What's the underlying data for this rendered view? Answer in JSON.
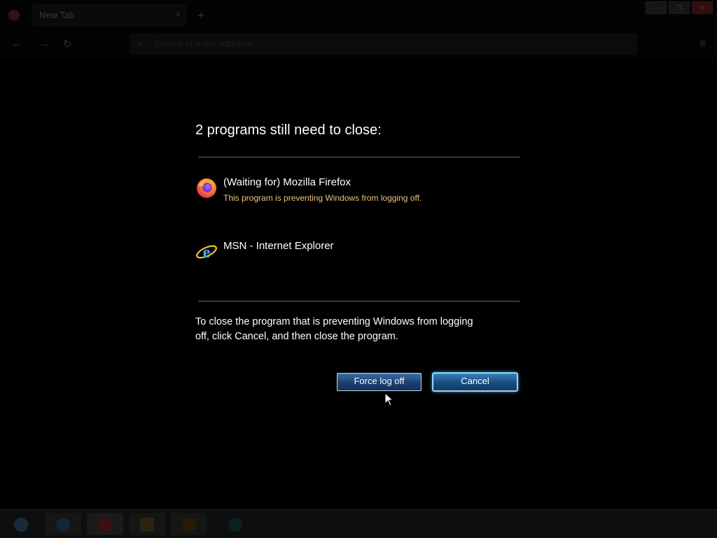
{
  "browser": {
    "tab_title": "New Tab",
    "tab_close": "×",
    "new_tab": "+",
    "search_placeholder": "Search or enter address",
    "window_buttons": [
      "—",
      "❐",
      "✕"
    ]
  },
  "dialog": {
    "title": "2 programs still need to close:",
    "programs": [
      {
        "name": "(Waiting for) Mozilla Firefox",
        "status": "This program is preventing Windows from logging off.",
        "icon": "firefox-icon"
      },
      {
        "name": "MSN - Internet Explorer",
        "icon": "internet-explorer-icon"
      }
    ],
    "instructions": "To close the program that is preventing Windows from logging off, click Cancel, and then close the program.",
    "force_button": "Force log off",
    "cancel_button": "Cancel"
  },
  "colors": {
    "status_text": "#f0c27a",
    "button_top": "#3a6ea8",
    "button_bottom": "#15335a",
    "focus_glow": "#5ec8ff"
  }
}
